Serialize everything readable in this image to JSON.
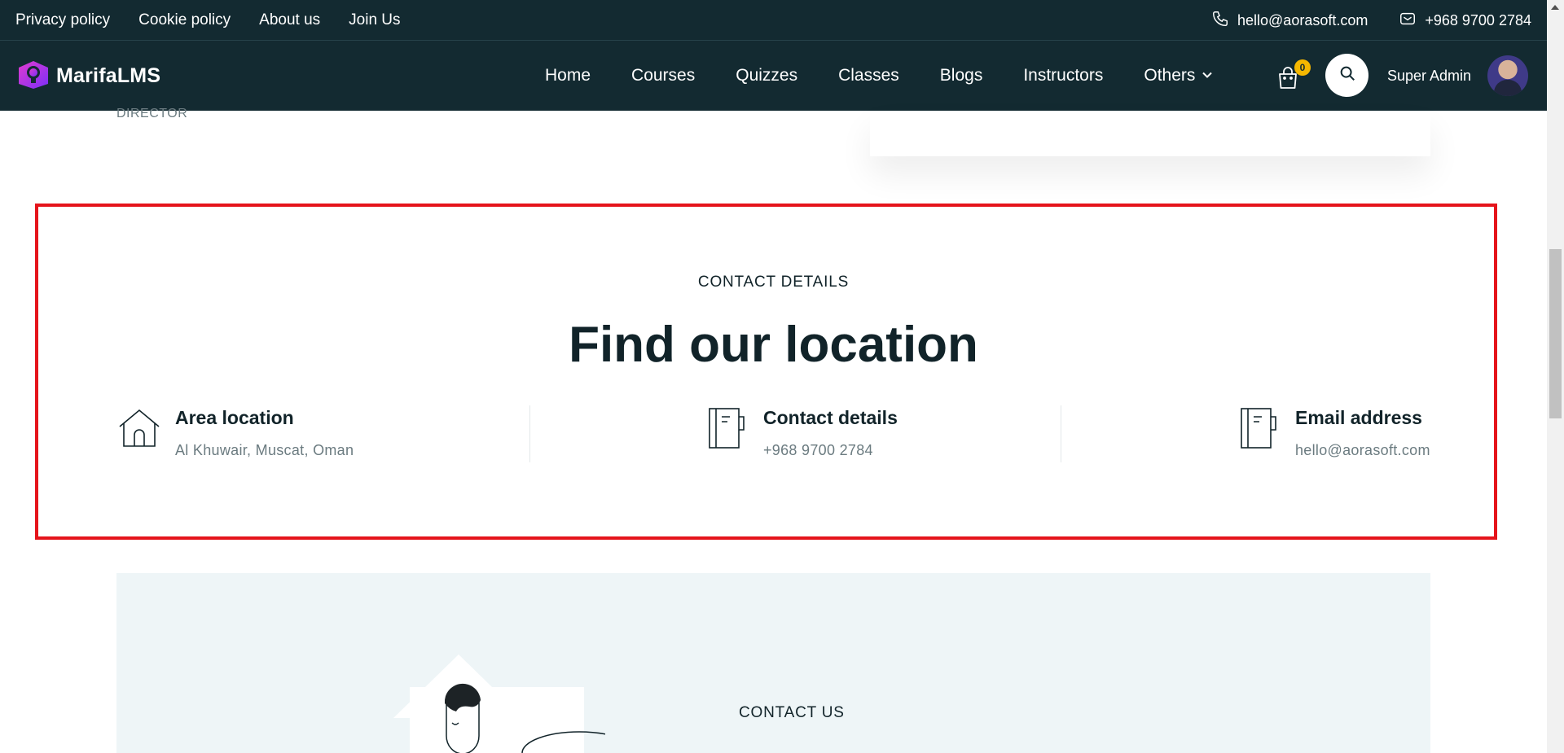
{
  "topbar": {
    "links": [
      "Privacy policy",
      "Cookie policy",
      "About us",
      "Join Us"
    ],
    "email": "hello@aorasoft.com",
    "phone": "+968 9700 2784"
  },
  "navbar": {
    "logo_text": "MarifaLMS",
    "items": [
      "Home",
      "Courses",
      "Quizzes",
      "Classes",
      "Blogs",
      "Instructors"
    ],
    "others_label": "Others",
    "cart_count": "0",
    "user_name": "Super Admin"
  },
  "above_section": {
    "role_label": "DIRECTOR"
  },
  "contact_details": {
    "kicker": "CONTACT DETAILS",
    "title": "Find our location",
    "items": [
      {
        "title": "Area location",
        "value": "Al Khuwair, Muscat, Oman",
        "icon": "home-icon"
      },
      {
        "title": "Contact details",
        "value": "+968 9700 2784",
        "icon": "notebook-icon"
      },
      {
        "title": "Email address",
        "value": "hello@aorasoft.com",
        "icon": "notebook-icon"
      }
    ]
  },
  "contact_us": {
    "kicker": "CONTACT US"
  },
  "colors": {
    "nav_bg": "#132a31",
    "highlight": "#e5141b",
    "badge": "#f5b700",
    "panel_bg": "#eef5f7"
  }
}
